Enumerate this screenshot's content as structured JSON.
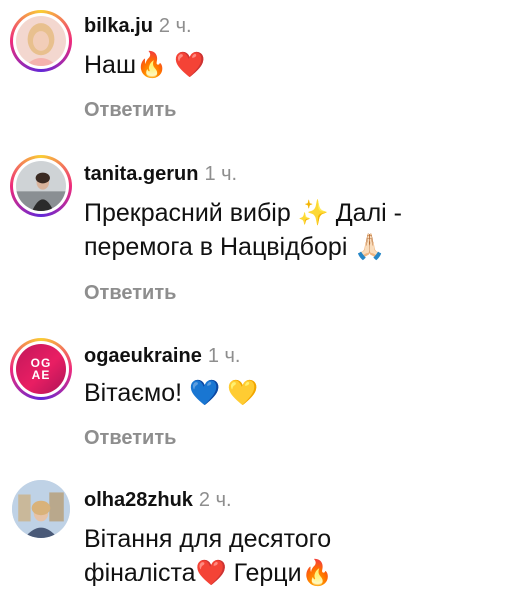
{
  "comments": [
    {
      "username": "bilka.ju",
      "time": "2 ч.",
      "text": "Наш🔥 ❤️",
      "reply": "Ответить",
      "avatar": "woman-blonde"
    },
    {
      "username": "tanita.gerun",
      "time": "1 ч.",
      "text": "Прекрасний вибір ✨ Далі -\nперемога в Нацвідборі 🙏🏻",
      "reply": "Ответить",
      "avatar": "woman-outdoor"
    },
    {
      "username": "ogaeukraine",
      "time": "1 ч.",
      "text": "Вітаємо! 💙 💛",
      "reply": "Ответить",
      "avatar": "ogae-logo",
      "avatar_text": "OG AE"
    },
    {
      "username": "olha28zhuk",
      "time": "2 ч.",
      "text": "Вітання для десятого\nфіналіста❤️  Герци🔥",
      "reply": "",
      "avatar": "woman-city"
    }
  ]
}
